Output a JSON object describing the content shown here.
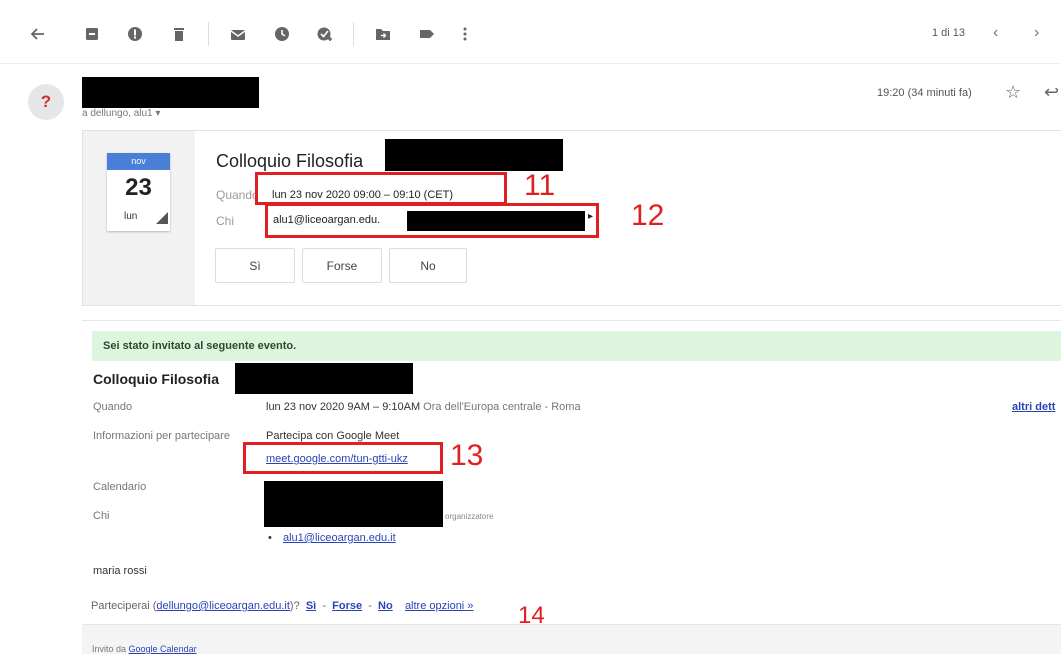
{
  "toolbar": {
    "pager": "1 di 13",
    "icons": [
      "back-icon",
      "archive-icon",
      "spam-icon",
      "delete-icon",
      "mark-unread-icon",
      "snooze-icon",
      "add-task-icon",
      "move-to-icon",
      "label-icon",
      "more-icon"
    ]
  },
  "sender": {
    "avatar": "?",
    "recipient_line": "a dellungo, alu1",
    "time": "19:20 (34 minuti fa)"
  },
  "invite": {
    "cal_month": "nov",
    "cal_day": "23",
    "cal_dow": "lun",
    "title": "Colloquio Filosofia",
    "when_label": "Quando",
    "when_value": "lun 23 nov 2020 09:00 – 09:10 (CET)",
    "who_label": "Chi",
    "who_value": "alu1@liceoargan.edu.",
    "rsvp": [
      "Sì",
      "Forse",
      "No"
    ]
  },
  "annotations": {
    "a11": "11",
    "a12": "12",
    "a13": "13",
    "a14": "14"
  },
  "details": {
    "banner": "Sei stato invitato al seguente evento.",
    "title": "Colloquio Filosofia",
    "when_label": "Quando",
    "when_value": "lun 23 nov 2020 9AM – 9:10AM",
    "when_tz": "Ora dell'Europa centrale - Roma",
    "more_details": "altri dett",
    "join_label": "Informazioni per partecipare",
    "join_value": "Partecipa con Google Meet",
    "meet_link": "meet.google.com/tun-gtti-ukz",
    "calendar_label": "Calendario",
    "who_label": "Chi",
    "organizer_tag": "organizzatore",
    "attendee": "alu1@liceoargan.edu.it",
    "signature": "maria rossi",
    "attend_question_prefix": "Parteciperai (",
    "attend_email": "dellungo@liceoargan.edu.it",
    "attend_question_suffix": ")?",
    "opt_yes": "Sì",
    "opt_maybe": "Forse",
    "opt_no": "No",
    "sep": "-",
    "more_options": "altre opzioni »"
  },
  "footer": {
    "prefix": "Invito da ",
    "link": "Google Calendar"
  }
}
